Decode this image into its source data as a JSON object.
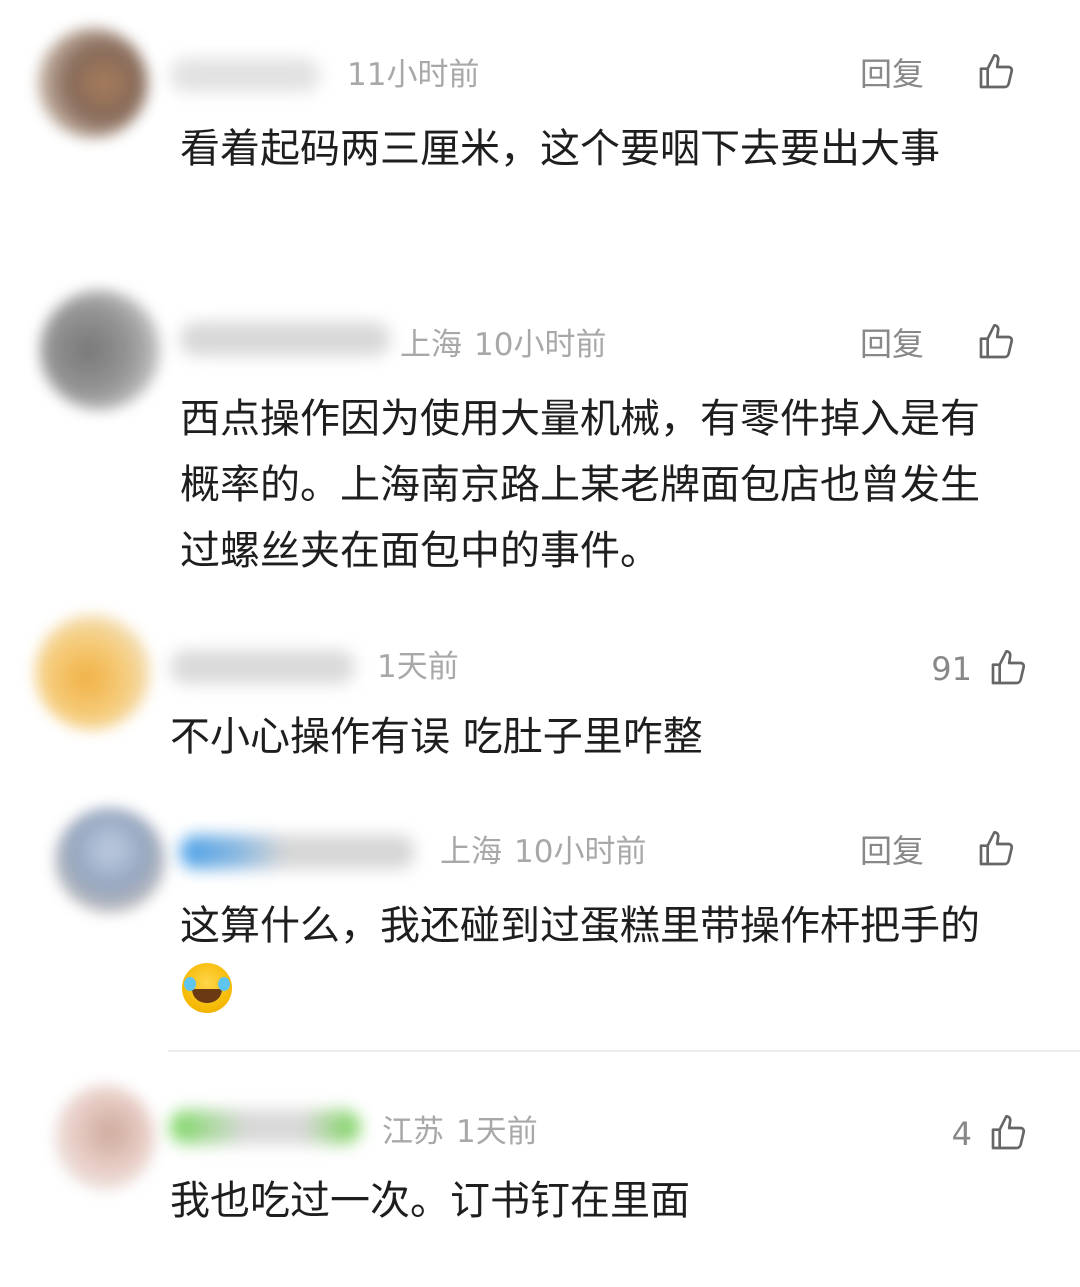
{
  "comments": [
    {
      "location": "",
      "time": "11小时前",
      "reply": "回复",
      "likes": "",
      "text": "看着起码两三厘米，这个要咽下去要出大事"
    },
    {
      "location": "上海",
      "time": "10小时前",
      "reply": "回复",
      "likes": "",
      "text": "西点操作因为使用大量机械，有零件掉入是有概率的。上海南京路上某老牌面包店也曾发生过螺丝夹在面包中的事件。"
    },
    {
      "location": "",
      "time": "1天前",
      "reply": "",
      "likes": "91",
      "text": "不小心操作有误 吃肚子里咋整"
    },
    {
      "location": "上海",
      "time": "10小时前",
      "reply": "回复",
      "likes": "",
      "text": "这算什么，我还碰到过蛋糕里带操作杆把手的"
    },
    {
      "location": "江苏",
      "time": "1天前",
      "reply": "",
      "likes": "4",
      "text": "我也吃过一次。订书钉在里面"
    }
  ],
  "icons": {
    "like": "thumbs-up-icon",
    "emoji": "laughing-tears-emoji"
  },
  "colors": {
    "meta": "#a8a8a8",
    "text": "#1e1e1e",
    "action": "#888888"
  }
}
